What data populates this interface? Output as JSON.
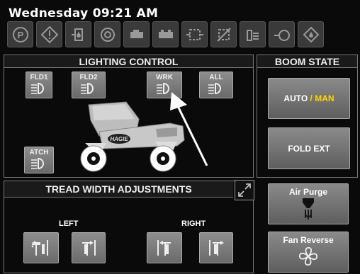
{
  "header": {
    "datetime": "Wednesday 09:21 AM"
  },
  "status_icons": [
    "parking-brake-icon",
    "warning-icon",
    "fuel-water-icon",
    "engine-check-icon",
    "hydraulic-icon",
    "battery-icon",
    "dpf-icon",
    "regen-inhibit-icon",
    "def-icon",
    "coolant-icon",
    "oil-pressure-icon"
  ],
  "lighting": {
    "title": "LIGHTING CONTROL",
    "buttons": {
      "fld1": "FLD1",
      "fld2": "FLD2",
      "wrk": "WRK",
      "all": "ALL",
      "atch": "ATCH"
    }
  },
  "boom": {
    "title": "BOOM STATE",
    "auto": "AUTO",
    "sep": "/",
    "man": "MAN",
    "fold_ext": "FOLD EXT"
  },
  "tread": {
    "title": "TREAD WIDTH ADJUSTMENTS",
    "left": "LEFT",
    "right": "RIGHT"
  },
  "air_purge": {
    "label": "Air Purge"
  },
  "fan_reverse": {
    "label": "Fan Reverse"
  },
  "vehicle": {
    "brand": "HAGIE"
  },
  "colors": {
    "accent_yellow": "#ffd400",
    "button_gray": "#7a7a7a",
    "background": "#0a0a0a"
  }
}
